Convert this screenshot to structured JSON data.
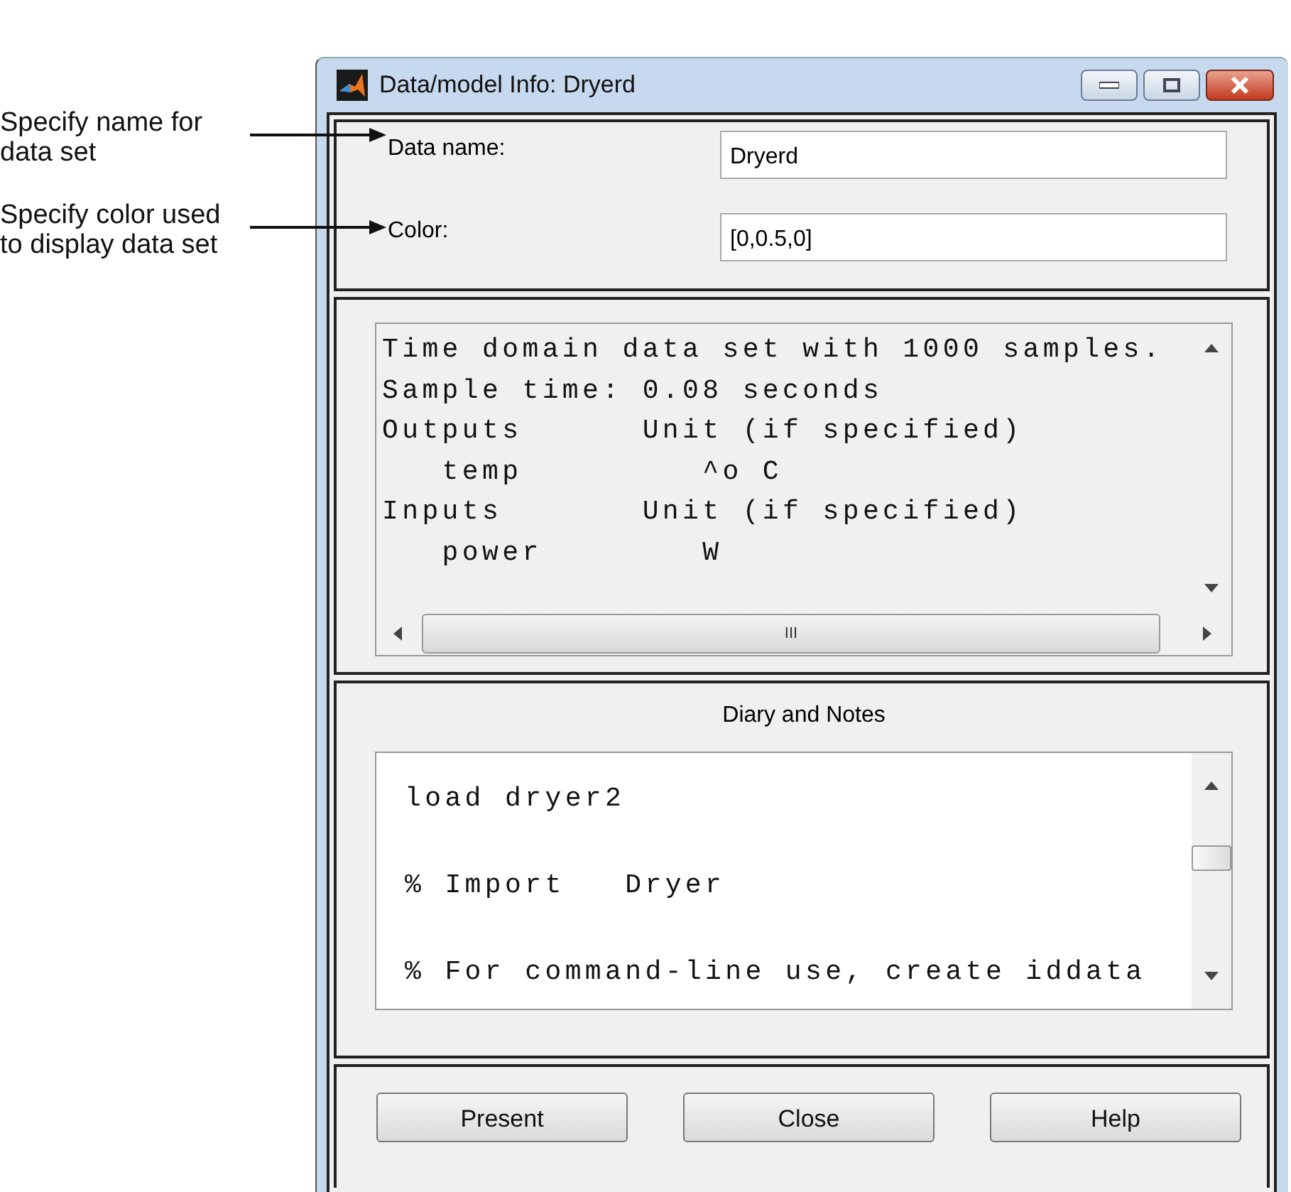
{
  "annotations": [
    {
      "text": "Specify name for data set"
    },
    {
      "text": "Specify color used to display data set"
    }
  ],
  "window": {
    "title": "Data/model Info: Dryerd"
  },
  "fields": [
    {
      "label": "Data name:",
      "value": "Dryerd"
    },
    {
      "label": "Color:",
      "value": "[0,0.5,0]"
    }
  ],
  "info": {
    "lines": [
      "Time domain data set with 1000 samples.",
      "Sample time: 0.08 seconds",
      "Outputs      Unit (if specified)",
      "   temp         ^o C",
      "Inputs       Unit (if specified)",
      "   power        W"
    ],
    "hscroll_grip": "III"
  },
  "diary": {
    "title": "Diary and Notes",
    "lines": [
      "load dryer2",
      "% Import   Dryer",
      "% For command-line use, create iddata"
    ]
  },
  "buttons": [
    "Present",
    "Close",
    "Help"
  ]
}
